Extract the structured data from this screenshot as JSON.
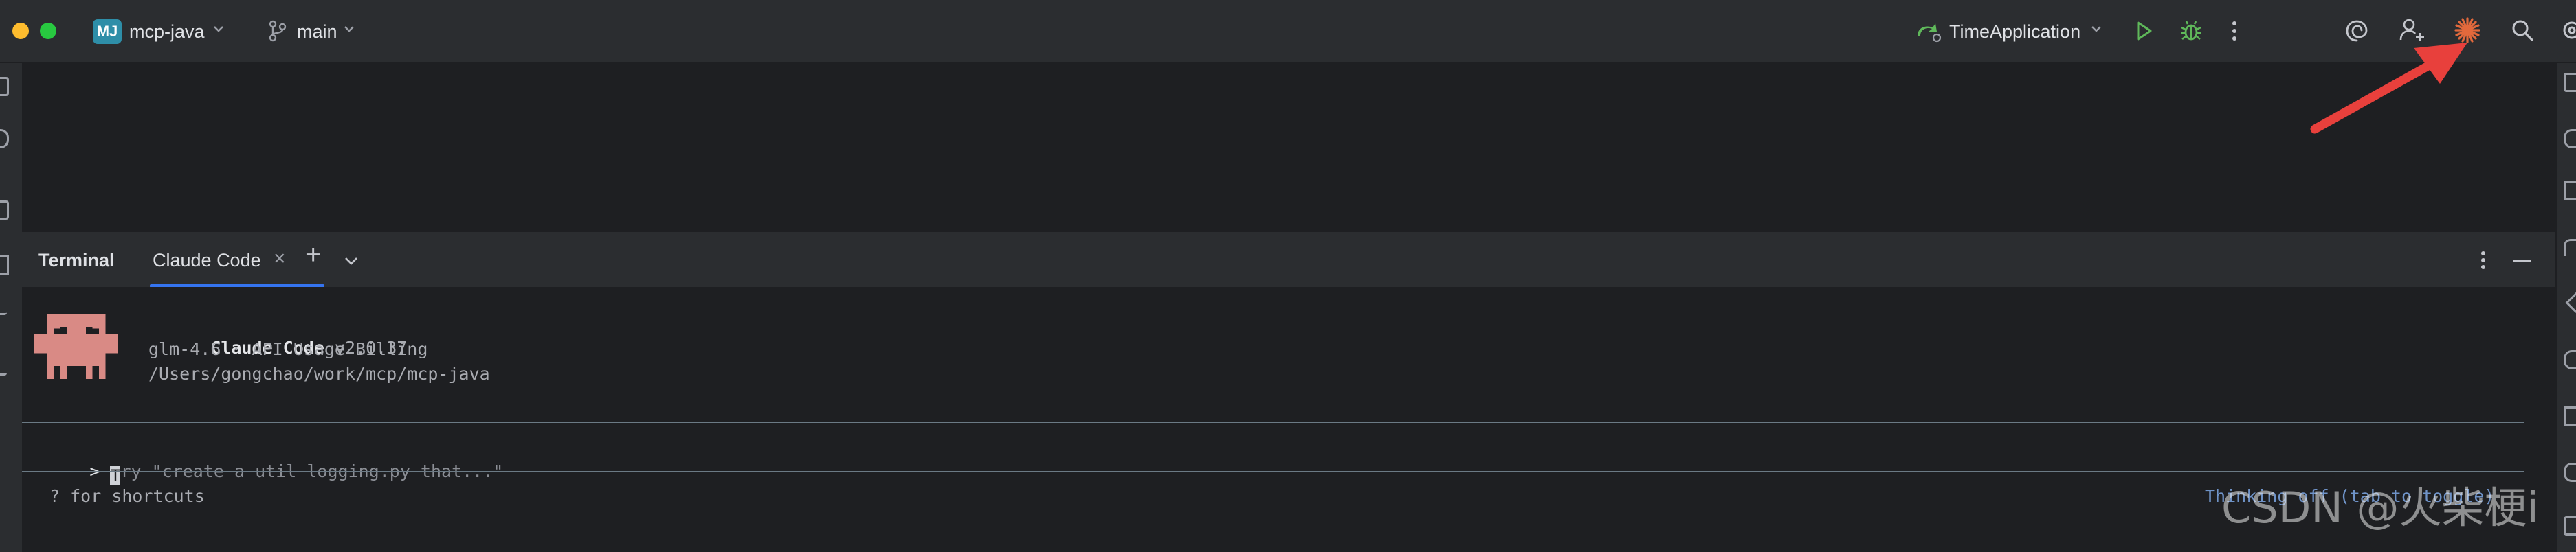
{
  "titlebar": {
    "project_badge": "MJ",
    "project_name": "mcp-java",
    "branch_name": "main",
    "run_config": "TimeApplication"
  },
  "icons": {
    "branch": "git-branch-icon",
    "run_config": "run-config-icon",
    "run": "run-play-icon",
    "debug": "debug-bug-icon",
    "more": "more-vertical-icon",
    "swirl": "ai-assistant-icon",
    "add_user": "add-user-icon",
    "claude": "claude-spark-icon",
    "search": "search-icon",
    "settings": "settings-gear-icon"
  },
  "terminal_panel": {
    "tabs": [
      {
        "label": "Terminal"
      },
      {
        "label": "Claude Code",
        "active": true
      }
    ],
    "close_tab": "×",
    "add_tab": "+",
    "dropdown": "⌄"
  },
  "claude_code": {
    "name": "Claude Code",
    "version": "v2.0.37",
    "model_line": "glm-4.6 · API Usage Billing",
    "cwd": "/Users/gongchao/work/mcp/mcp-java",
    "prompt_symbol": ">",
    "prompt_cursor_char": "T",
    "prompt_placeholder": "ry \"create a util logging.py that...\"",
    "shortcuts_hint": "? for shortcuts",
    "thinking_hint": "Thinking off (tab to toggle)"
  },
  "watermark": "CSDN @火柴梗i",
  "colors": {
    "accent_blue": "#3574f0",
    "arrow_red": "#e8403c",
    "claude_orange": "#e2693c",
    "mascot": "#d98a85",
    "run_green": "#5fb85a",
    "badge_teal": "#2e8ea8"
  }
}
